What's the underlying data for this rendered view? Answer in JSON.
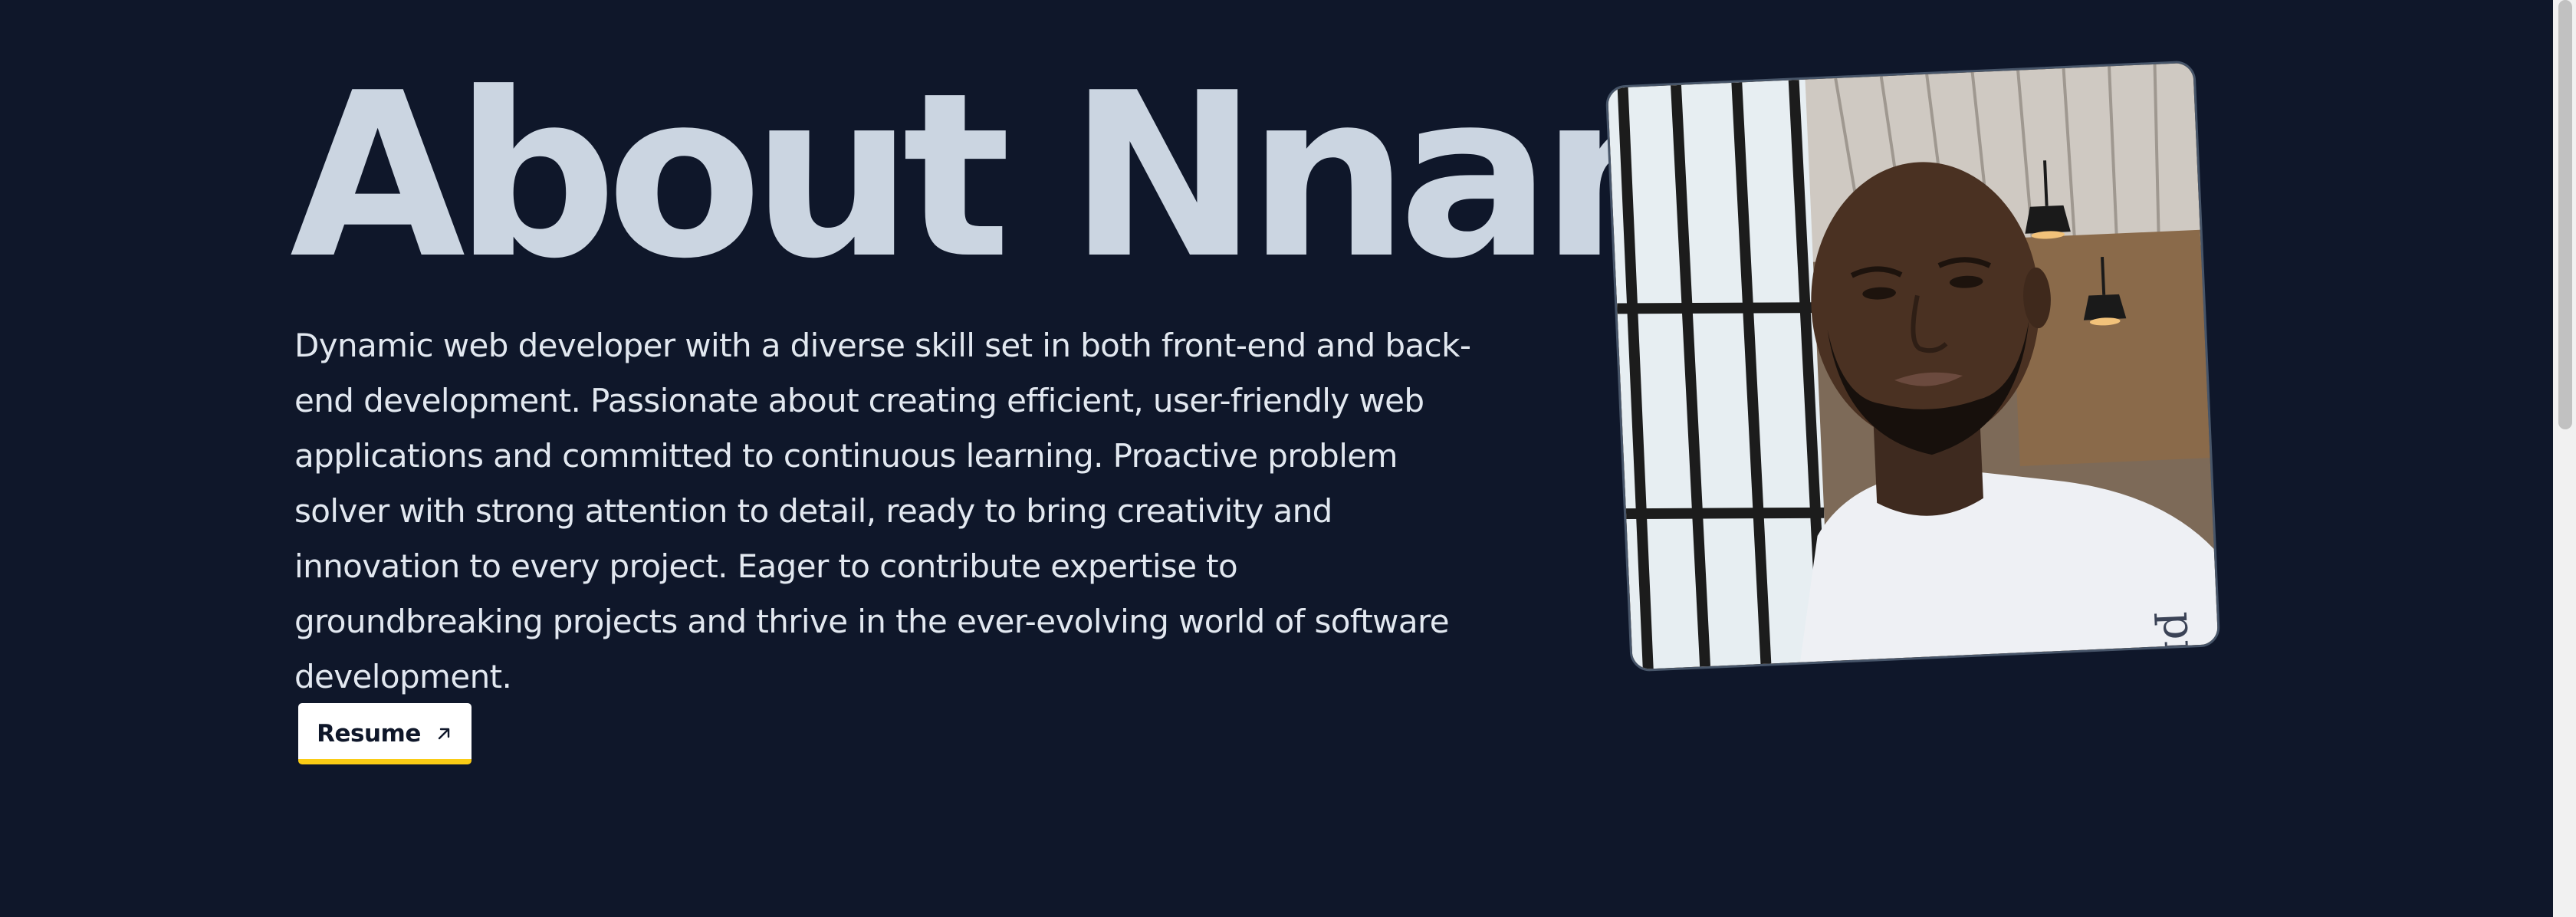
{
  "about": {
    "heading": "About Nnamdi",
    "bio": "Dynamic web developer with a diverse skill set in both front-end and back-end development. Passionate about creating efficient, user-friendly web applications and committed to continuous learning. Proactive problem solver with strong attention to detail, ready to bring creativity and innovation to every project. Eager to contribute expertise to groundbreaking projects and thrive in the ever-evolving world of software development.",
    "resume_button": {
      "label": "Resume",
      "icon": "arrow-up-right-icon"
    },
    "photo": {
      "shirt_text": "pre"
    }
  },
  "theme": {
    "background": "#0f172a",
    "heading_color": "#cbd5e1",
    "text_color": "#e2e8f0",
    "button_accent": "#facc15"
  }
}
